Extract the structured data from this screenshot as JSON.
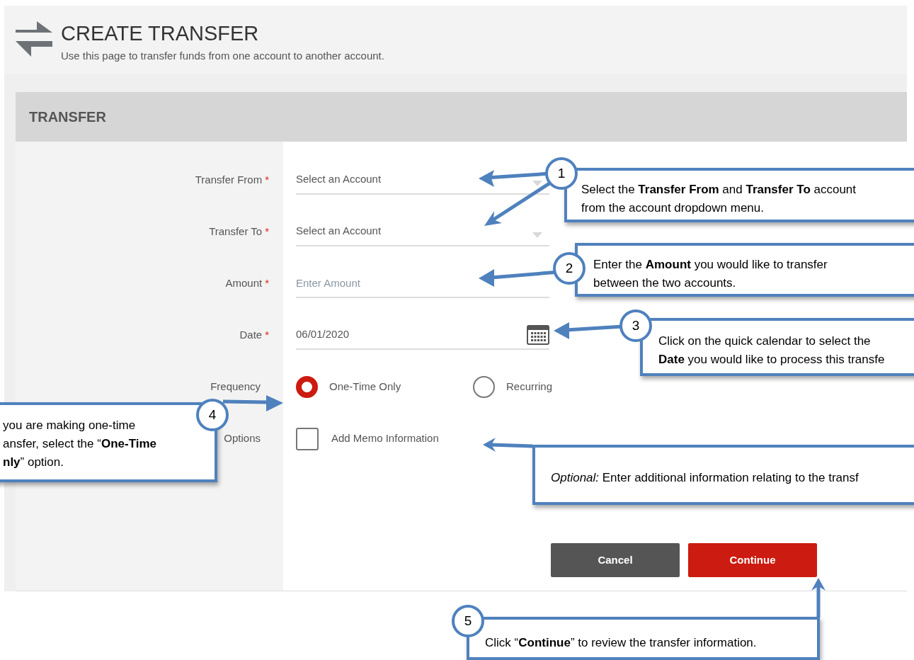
{
  "header": {
    "title": "CREATE TRANSFER",
    "subtitle": "Use this page to transfer funds from one account to another account."
  },
  "panel": {
    "title": "TRANSFER",
    "required_mark": "*",
    "fields": [
      {
        "kind": "select",
        "label": "Transfer From",
        "required": true,
        "value": "Select an Account"
      },
      {
        "kind": "select",
        "label": "Transfer To",
        "required": true,
        "value": "Select an Account"
      },
      {
        "kind": "input",
        "label": "Amount",
        "required": true,
        "placeholder": "Enter Amount"
      },
      {
        "kind": "date",
        "label": "Date",
        "required": true,
        "value": "06/01/2020"
      },
      {
        "kind": "radio",
        "label": "Frequency",
        "required": false,
        "options": [
          {
            "label": "One-Time Only",
            "selected": true
          },
          {
            "label": "Recurring",
            "selected": false
          }
        ]
      },
      {
        "kind": "checkbox",
        "label": "Options",
        "required": false,
        "option": {
          "label": "Add Memo Information",
          "checked": false
        }
      }
    ],
    "buttons": [
      {
        "kind": "secondary",
        "label": "Cancel"
      },
      {
        "kind": "primary",
        "label": "Continue"
      }
    ]
  },
  "callouts": [
    {
      "number": "1",
      "lines": [
        "Select the **Transfer From** and **Transfer To** account",
        "from the account dropdown menu."
      ]
    },
    {
      "number": "2",
      "lines": [
        "Enter the **Amount** you would like to transfer",
        "between the two accounts."
      ]
    },
    {
      "number": "3",
      "lines": [
        "Click on the quick calendar to select the",
        "**Date** you would like to process this transfe"
      ]
    },
    {
      "number": "4",
      "lines": [
        "you are making one-time",
        "ansfer, select the “**One-Time**",
        "**nly**” option."
      ]
    },
    {
      "lines": [
        "*Optional:* Enter additional information relating to the transf"
      ]
    },
    {
      "number": "5",
      "lines": [
        "Click “**Continue**” to review the transfer information."
      ]
    }
  ]
}
